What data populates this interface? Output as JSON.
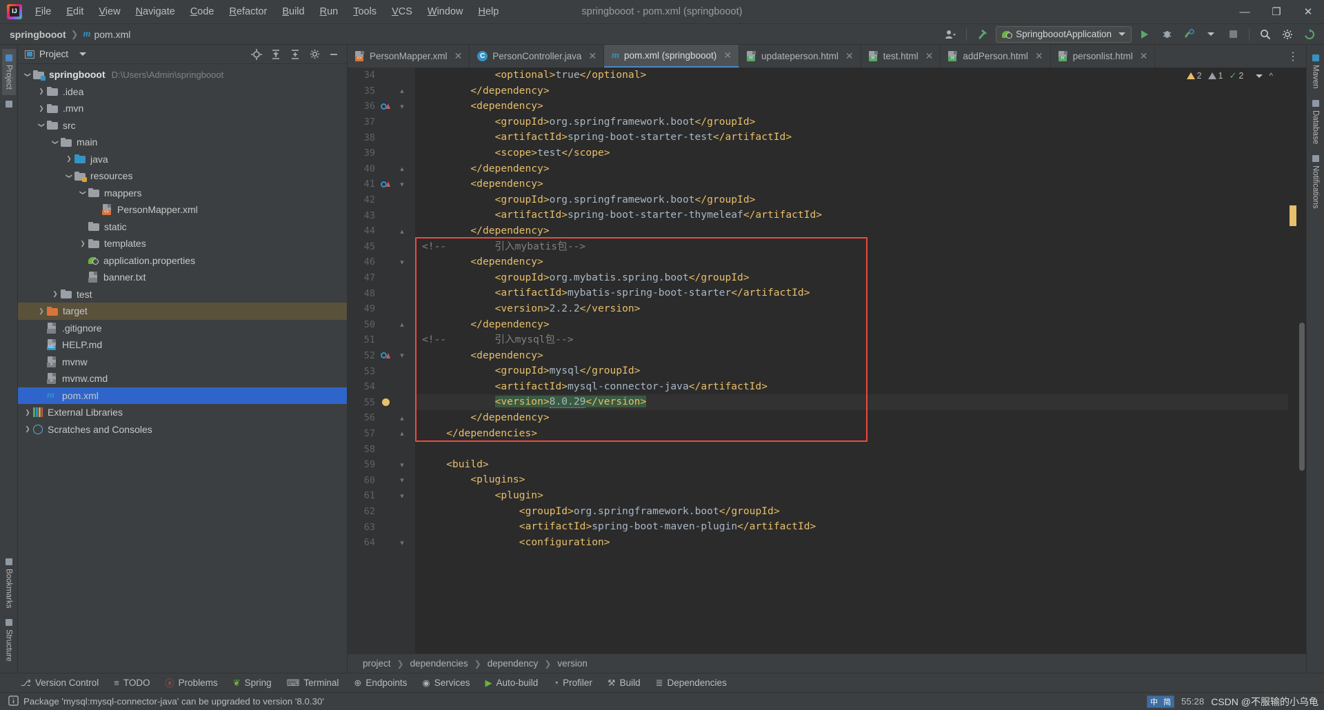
{
  "window": {
    "title": "springbooot - pom.xml (springbooot)",
    "minimize": "—",
    "maximize": "❐",
    "close": "✕"
  },
  "menubar": {
    "items": [
      "File",
      "Edit",
      "View",
      "Navigate",
      "Code",
      "Refactor",
      "Build",
      "Run",
      "Tools",
      "VCS",
      "Window",
      "Help"
    ]
  },
  "navbar": {
    "project": "springbooot",
    "file": "pom.xml",
    "run_config": "SpringboootApplication",
    "icons": {
      "profile": "user-icon",
      "build": "hammer-icon",
      "run": "run-icon",
      "debug": "debug-icon",
      "run_with_coverage": "coverage-icon",
      "more_run": "chevron-down-icon",
      "stop": "stop-icon",
      "search": "search-icon",
      "settings": "gear-icon",
      "updates": "update-icon"
    }
  },
  "left_rail": {
    "items": [
      "Project",
      "Commit"
    ]
  },
  "bottom_rail": {
    "items": [
      "Bookmarks",
      "Structure"
    ]
  },
  "right_rail": {
    "items": [
      "Maven",
      "Database",
      "Notifications"
    ]
  },
  "project_panel": {
    "title": "Project",
    "actions": [
      "locate-icon",
      "expand-all-icon",
      "collapse-all-icon",
      "gear-icon",
      "hide-icon"
    ],
    "tree": [
      {
        "depth": 0,
        "arrow": "d",
        "icon": "folder-module",
        "label": "springbooot",
        "bold": true,
        "path": "D:\\Users\\Admin\\springbooot",
        "state": "none"
      },
      {
        "depth": 1,
        "arrow": "r",
        "icon": "folder",
        "label": ".idea",
        "bold": false,
        "path": "",
        "state": "none"
      },
      {
        "depth": 1,
        "arrow": "r",
        "icon": "folder",
        "label": ".mvn",
        "bold": false,
        "path": "",
        "state": "none"
      },
      {
        "depth": 1,
        "arrow": "d",
        "icon": "folder",
        "label": "src",
        "bold": false,
        "path": "",
        "state": "none"
      },
      {
        "depth": 2,
        "arrow": "d",
        "icon": "folder",
        "label": "main",
        "bold": false,
        "path": "",
        "state": "none"
      },
      {
        "depth": 3,
        "arrow": "r",
        "icon": "folder-source",
        "label": "java",
        "bold": false,
        "path": "",
        "state": "none"
      },
      {
        "depth": 3,
        "arrow": "d",
        "icon": "folder-resources",
        "label": "resources",
        "bold": false,
        "path": "",
        "state": "none"
      },
      {
        "depth": 4,
        "arrow": "d",
        "icon": "folder",
        "label": "mappers",
        "bold": false,
        "path": "",
        "state": "none"
      },
      {
        "depth": 5,
        "arrow": "",
        "icon": "file-xml",
        "label": "PersonMapper.xml",
        "bold": false,
        "path": "",
        "state": "none"
      },
      {
        "depth": 4,
        "arrow": "",
        "icon": "folder",
        "label": "static",
        "bold": false,
        "path": "",
        "state": "none"
      },
      {
        "depth": 4,
        "arrow": "r",
        "icon": "folder",
        "label": "templates",
        "bold": false,
        "path": "",
        "state": "none"
      },
      {
        "depth": 4,
        "arrow": "",
        "icon": "file-spring",
        "label": "application.properties",
        "bold": false,
        "path": "",
        "state": "none"
      },
      {
        "depth": 4,
        "arrow": "",
        "icon": "file-txt",
        "label": "banner.txt",
        "bold": false,
        "path": "",
        "state": "none"
      },
      {
        "depth": 2,
        "arrow": "r",
        "icon": "folder",
        "label": "test",
        "bold": false,
        "path": "",
        "state": "none"
      },
      {
        "depth": 1,
        "arrow": "r",
        "icon": "folder-target",
        "label": "target",
        "bold": false,
        "path": "",
        "state": "target"
      },
      {
        "depth": 1,
        "arrow": "",
        "icon": "file-git",
        "label": ".gitignore",
        "bold": false,
        "path": "",
        "state": "none"
      },
      {
        "depth": 1,
        "arrow": "",
        "icon": "file-md",
        "label": "HELP.md",
        "bold": false,
        "path": "",
        "state": "none"
      },
      {
        "depth": 1,
        "arrow": "",
        "icon": "file-sh",
        "label": "mvnw",
        "bold": false,
        "path": "",
        "state": "none"
      },
      {
        "depth": 1,
        "arrow": "",
        "icon": "file-cmd",
        "label": "mvnw.cmd",
        "bold": false,
        "path": "",
        "state": "none"
      },
      {
        "depth": 1,
        "arrow": "",
        "icon": "file-maven",
        "label": "pom.xml",
        "bold": false,
        "path": "",
        "state": "selected"
      },
      {
        "depth": 0,
        "arrow": "r",
        "icon": "libraries",
        "label": "External Libraries",
        "bold": false,
        "path": "",
        "state": "none"
      },
      {
        "depth": 0,
        "arrow": "r",
        "icon": "scratches",
        "label": "Scratches and Consoles",
        "bold": false,
        "path": "",
        "state": "none"
      }
    ]
  },
  "editor": {
    "tabs": [
      {
        "label": "PersonMapper.xml",
        "icon": "xml-file-icon",
        "active": false
      },
      {
        "label": "PersonController.java",
        "icon": "java-class-icon",
        "active": false
      },
      {
        "label": "pom.xml (springbooot)",
        "icon": "maven-file-icon",
        "active": true
      },
      {
        "label": "updateperson.html",
        "icon": "html-file-icon",
        "active": false
      },
      {
        "label": "test.html",
        "icon": "html-file-icon",
        "active": false
      },
      {
        "label": "addPerson.html",
        "icon": "html-file-icon",
        "active": false
      },
      {
        "label": "personlist.html",
        "icon": "html-file-icon",
        "active": false
      }
    ],
    "tab_overflow": "⋮",
    "inspections": {
      "warnings": "2",
      "weak_warnings": "1",
      "checks": "2"
    },
    "first_line_number": 34,
    "current_line": 55,
    "lines": [
      {
        "n": 34,
        "indent": 12,
        "text": "<optional>true</optional>",
        "kind": "tag",
        "mark": "",
        "fold": "",
        "cut_top": true
      },
      {
        "n": 35,
        "indent": 8,
        "text": "</dependency>",
        "kind": "tag",
        "mark": "",
        "fold": "end"
      },
      {
        "n": 36,
        "indent": 8,
        "text": "<dependency>",
        "kind": "tag",
        "mark": "run",
        "fold": "start"
      },
      {
        "n": 37,
        "indent": 12,
        "text": "<groupId>org.springframework.boot</groupId>",
        "kind": "mix",
        "mark": "",
        "fold": ""
      },
      {
        "n": 38,
        "indent": 12,
        "text": "<artifactId>spring-boot-starter-test</artifactId>",
        "kind": "mix",
        "mark": "",
        "fold": ""
      },
      {
        "n": 39,
        "indent": 12,
        "text": "<scope>test</scope>",
        "kind": "mix",
        "mark": "",
        "fold": ""
      },
      {
        "n": 40,
        "indent": 8,
        "text": "</dependency>",
        "kind": "tag",
        "mark": "",
        "fold": "end"
      },
      {
        "n": 41,
        "indent": 8,
        "text": "<dependency>",
        "kind": "tag",
        "mark": "run",
        "fold": "start"
      },
      {
        "n": 42,
        "indent": 12,
        "text": "<groupId>org.springframework.boot</groupId>",
        "kind": "mix",
        "mark": "",
        "fold": ""
      },
      {
        "n": 43,
        "indent": 12,
        "text": "<artifactId>spring-boot-starter-thymeleaf</artifactId>",
        "kind": "mix",
        "mark": "",
        "fold": ""
      },
      {
        "n": 44,
        "indent": 8,
        "text": "</dependency>",
        "kind": "tag",
        "mark": "",
        "fold": "end"
      },
      {
        "n": 45,
        "indent": 0,
        "text": "<!--        引入mybatis包-->",
        "kind": "comment",
        "mark": "",
        "fold": ""
      },
      {
        "n": 46,
        "indent": 8,
        "text": "<dependency>",
        "kind": "tag",
        "mark": "",
        "fold": "start"
      },
      {
        "n": 47,
        "indent": 12,
        "text": "<groupId>org.mybatis.spring.boot</groupId>",
        "kind": "mix",
        "mark": "",
        "fold": ""
      },
      {
        "n": 48,
        "indent": 12,
        "text": "<artifactId>mybatis-spring-boot-starter</artifactId>",
        "kind": "mix",
        "mark": "",
        "fold": ""
      },
      {
        "n": 49,
        "indent": 12,
        "text": "<version>2.2.2</version>",
        "kind": "mix",
        "mark": "",
        "fold": ""
      },
      {
        "n": 50,
        "indent": 8,
        "text": "</dependency>",
        "kind": "tag",
        "mark": "",
        "fold": "end"
      },
      {
        "n": 51,
        "indent": 0,
        "text": "<!--        引入mysql包-->",
        "kind": "comment",
        "mark": "",
        "fold": ""
      },
      {
        "n": 52,
        "indent": 8,
        "text": "<dependency>",
        "kind": "tag",
        "mark": "run",
        "fold": "start"
      },
      {
        "n": 53,
        "indent": 12,
        "text": "<groupId>mysql</groupId>",
        "kind": "mix",
        "mark": "",
        "fold": ""
      },
      {
        "n": 54,
        "indent": 12,
        "text": "<artifactId>mysql-connector-java</artifactId>",
        "kind": "mix",
        "mark": "",
        "fold": ""
      },
      {
        "n": 55,
        "indent": 12,
        "text": "<version>8.0.29</version>",
        "kind": "version-highlight",
        "mark": "bulb",
        "fold": "",
        "current": true
      },
      {
        "n": 56,
        "indent": 8,
        "text": "</dependency>",
        "kind": "tag",
        "mark": "",
        "fold": "end"
      },
      {
        "n": 57,
        "indent": 4,
        "text": "</dependencies>",
        "kind": "tag",
        "mark": "",
        "fold": "end"
      },
      {
        "n": 58,
        "indent": 0,
        "text": "",
        "kind": "tag",
        "mark": "",
        "fold": ""
      },
      {
        "n": 59,
        "indent": 4,
        "text": "<build>",
        "kind": "tag",
        "mark": "",
        "fold": "start"
      },
      {
        "n": 60,
        "indent": 8,
        "text": "<plugins>",
        "kind": "tag",
        "mark": "",
        "fold": "start"
      },
      {
        "n": 61,
        "indent": 12,
        "text": "<plugin>",
        "kind": "tag",
        "mark": "",
        "fold": "start"
      },
      {
        "n": 62,
        "indent": 16,
        "text": "<groupId>org.springframework.boot</groupId>",
        "kind": "mix",
        "mark": "",
        "fold": ""
      },
      {
        "n": 63,
        "indent": 16,
        "text": "<artifactId>spring-boot-maven-plugin</artifactId>",
        "kind": "mix",
        "mark": "",
        "fold": ""
      },
      {
        "n": 64,
        "indent": 16,
        "text": "<configuration>",
        "kind": "tag",
        "mark": "",
        "fold": "start"
      }
    ],
    "highlight_box": {
      "label": "red-annotation-box",
      "color": "#f0493e"
    },
    "breadcrumb": [
      "project",
      "dependencies",
      "dependency",
      "version"
    ]
  },
  "toolwindows": {
    "items": [
      {
        "label": "Version Control",
        "icon": "branch-icon"
      },
      {
        "label": "TODO",
        "icon": "list-icon"
      },
      {
        "label": "Problems",
        "icon": "error-icon"
      },
      {
        "label": "Spring",
        "icon": "spring-icon"
      },
      {
        "label": "Terminal",
        "icon": "terminal-icon"
      },
      {
        "label": "Endpoints",
        "icon": "endpoints-icon"
      },
      {
        "label": "Services",
        "icon": "services-icon"
      },
      {
        "label": "Auto-build",
        "icon": "autobuild-icon"
      },
      {
        "label": "Profiler",
        "icon": "profiler-icon"
      },
      {
        "label": "Build",
        "icon": "build-icon"
      },
      {
        "label": "Dependencies",
        "icon": "dependencies-icon"
      }
    ]
  },
  "statusbar": {
    "message": "Package 'mysql:mysql-connector-java' can be upgraded to version '8.0.30'",
    "icon": "info-icon",
    "caret_position": "55:28",
    "ime": {
      "left": "中",
      "right": "简"
    },
    "watermark": "CSDN @不服输的小乌龟"
  }
}
